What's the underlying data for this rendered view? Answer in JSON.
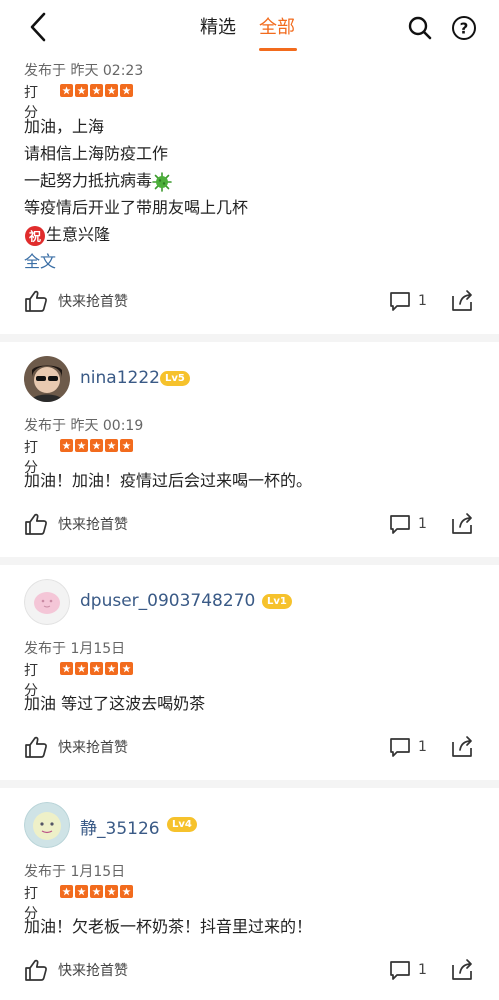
{
  "header": {
    "tabs": [
      {
        "label": "精选",
        "active": false
      },
      {
        "label": "全部",
        "active": true
      }
    ],
    "accent_color": "#f26b1d"
  },
  "reviews": [
    {
      "published": "发布于 昨天 02:23",
      "rating_label": "打分",
      "rating": 5,
      "content_lines": [
        "加油，上海",
        "请相信上海防疫工作",
        "一起努力抵抗病毒",
        "等疫情后开业了带朋友喝上几杯",
        "生意兴隆"
      ],
      "content_emojis": [
        "virus-icon",
        "blessing-icon"
      ],
      "full_text_link": "全文",
      "like_label": "快来抢首赞",
      "comment_count": "1"
    },
    {
      "username": "nina1222",
      "level": "Lv5",
      "published": "发布于 昨天 00:19",
      "rating_label": "打分",
      "rating": 5,
      "content": "加油！加油！疫情过后会过来喝一杯的。",
      "like_label": "快来抢首赞",
      "comment_count": "1"
    },
    {
      "username": "dpuser_0903748270",
      "level": "Lv1",
      "published": "发布于 1月15日",
      "rating_label": "打分",
      "rating": 5,
      "content": "加油 等过了这波去喝奶茶",
      "like_label": "快来抢首赞",
      "comment_count": "1"
    },
    {
      "username": "静_35126",
      "level": "Lv4",
      "published": "发布于 1月15日",
      "rating_label": "打分",
      "rating": 5,
      "content": "加油！欠老板一杯奶茶！抖音里过来的！",
      "like_label": "快来抢首赞",
      "comment_count": "1"
    }
  ]
}
